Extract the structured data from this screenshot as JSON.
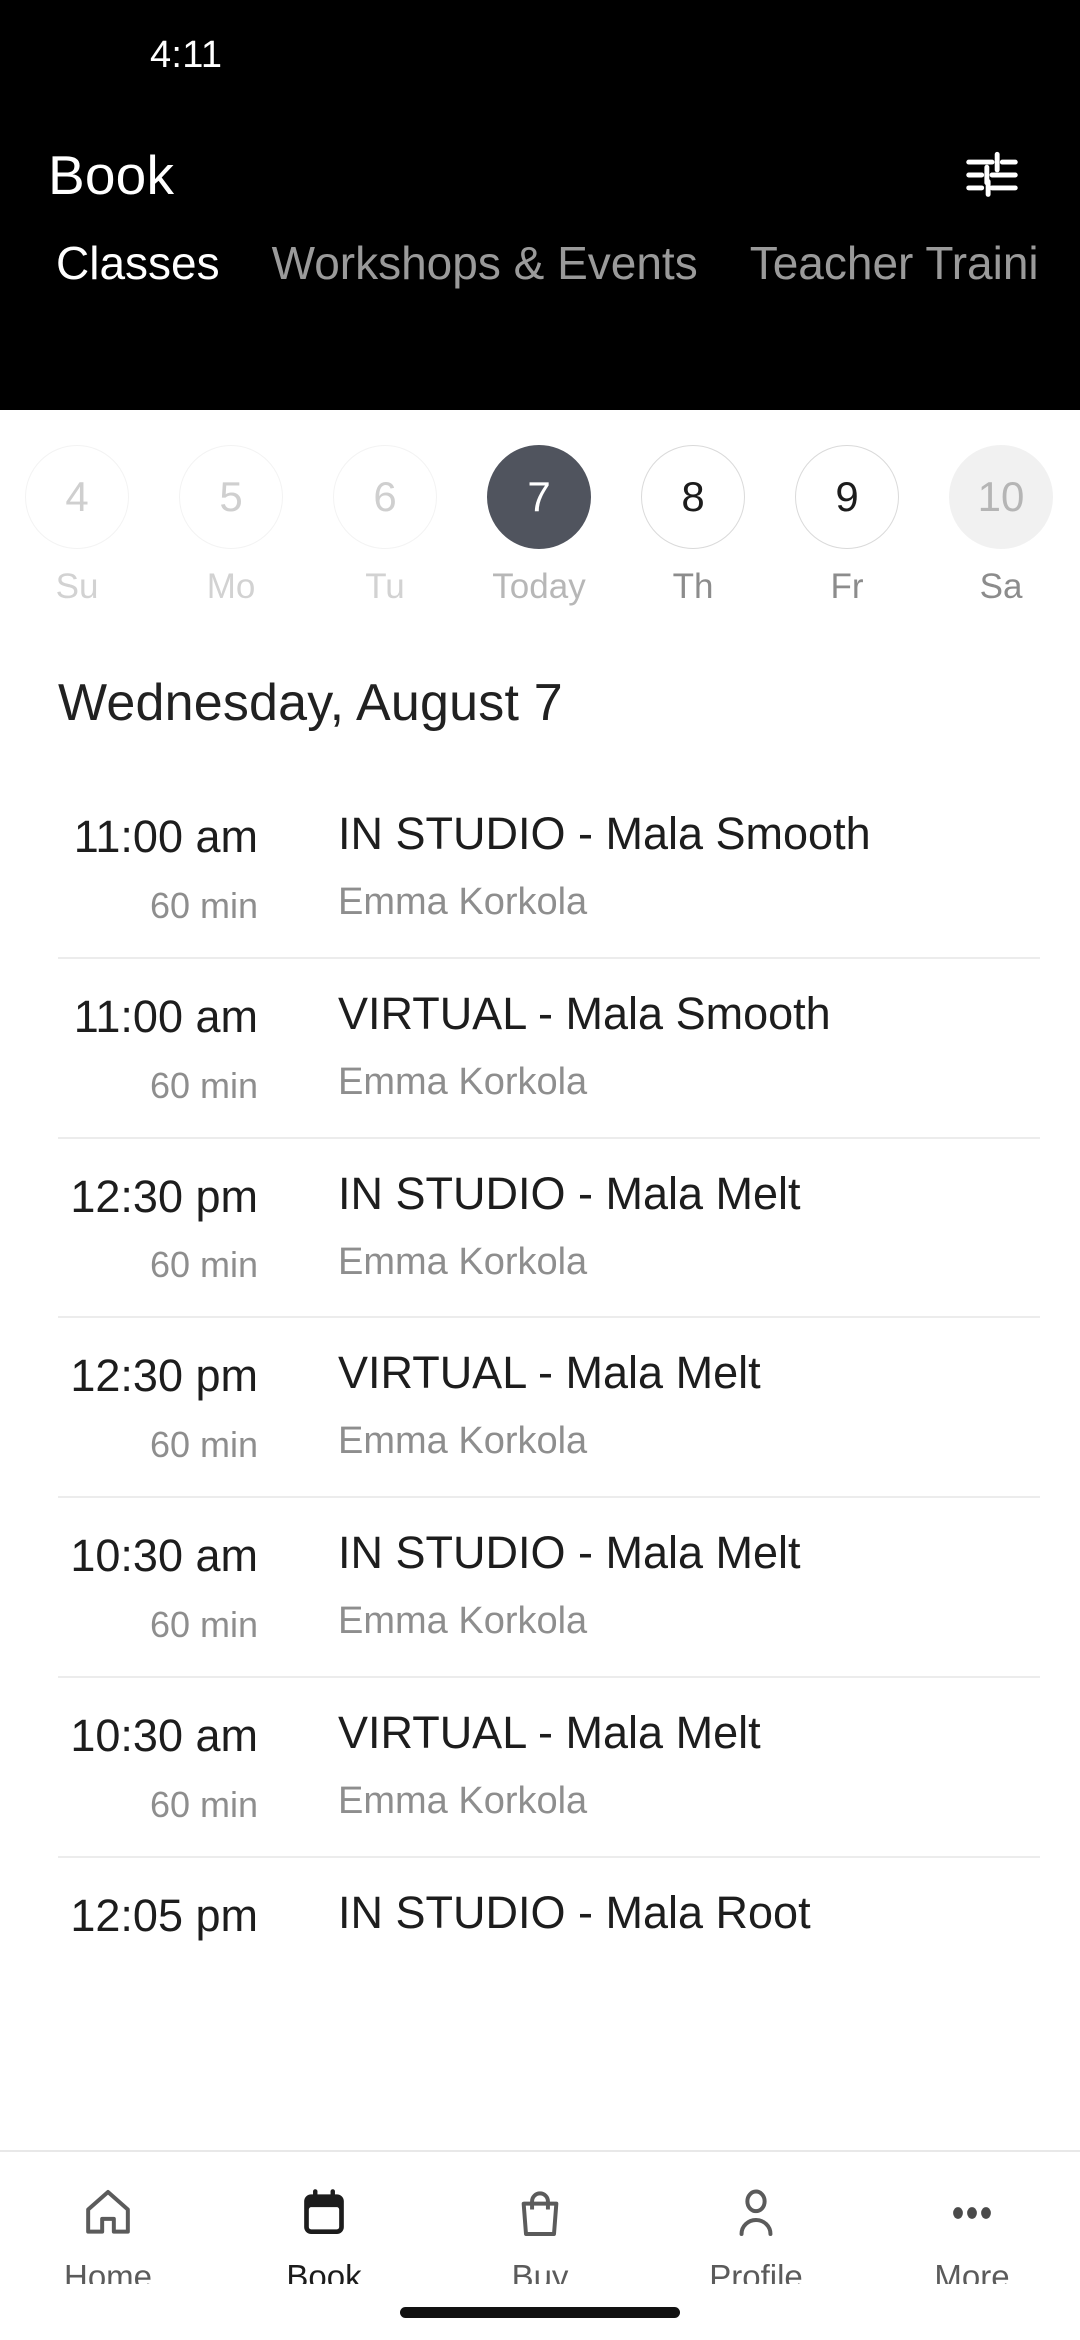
{
  "status_bar": {
    "time": "4:11"
  },
  "header": {
    "title": "Book",
    "filter_icon": "tune-filter-icon",
    "background_color": "#000000"
  },
  "tabs": [
    {
      "label": "Classes",
      "active": true
    },
    {
      "label": "Workshops & Events",
      "active": false
    },
    {
      "label": "Teacher Traini",
      "active": false
    }
  ],
  "date_strip": {
    "days": [
      {
        "number": "4",
        "label": "Su",
        "state": "past"
      },
      {
        "number": "5",
        "label": "Mo",
        "state": "past"
      },
      {
        "number": "6",
        "label": "Tu",
        "state": "past"
      },
      {
        "number": "7",
        "label": "Today",
        "state": "selected"
      },
      {
        "number": "8",
        "label": "Th",
        "state": "future"
      },
      {
        "number": "9",
        "label": "Fr",
        "state": "future"
      },
      {
        "number": "10",
        "label": "Sa",
        "state": "muted"
      }
    ],
    "selected_color": "#50545e"
  },
  "date_heading": "Wednesday, August 7",
  "classes": [
    {
      "time": "11:00 am",
      "duration": "60 min",
      "name": "IN STUDIO - Mala Smooth",
      "instructor": "Emma Korkola"
    },
    {
      "time": "11:00 am",
      "duration": "60 min",
      "name": "VIRTUAL - Mala Smooth",
      "instructor": "Emma Korkola"
    },
    {
      "time": "12:30 pm",
      "duration": "60 min",
      "name": "IN STUDIO - Mala Melt",
      "instructor": "Emma Korkola"
    },
    {
      "time": "12:30 pm",
      "duration": "60 min",
      "name": "VIRTUAL - Mala Melt",
      "instructor": "Emma Korkola"
    },
    {
      "time": "10:30 am",
      "duration": "60 min",
      "name": "IN STUDIO - Mala Melt",
      "instructor": "Emma Korkola"
    },
    {
      "time": "10:30 am",
      "duration": "60 min",
      "name": "VIRTUAL - Mala Melt",
      "instructor": "Emma Korkola"
    },
    {
      "time": "12:05 pm",
      "duration": "",
      "name": "IN STUDIO - Mala Root",
      "instructor": ""
    }
  ],
  "bottom_nav": [
    {
      "label": "Home",
      "icon": "home-icon",
      "active": false
    },
    {
      "label": "Book",
      "icon": "calendar-icon",
      "active": true
    },
    {
      "label": "Buy",
      "icon": "bag-icon",
      "active": false
    },
    {
      "label": "Profile",
      "icon": "person-icon",
      "active": false
    },
    {
      "label": "More",
      "icon": "more-dots-icon",
      "active": false
    }
  ]
}
